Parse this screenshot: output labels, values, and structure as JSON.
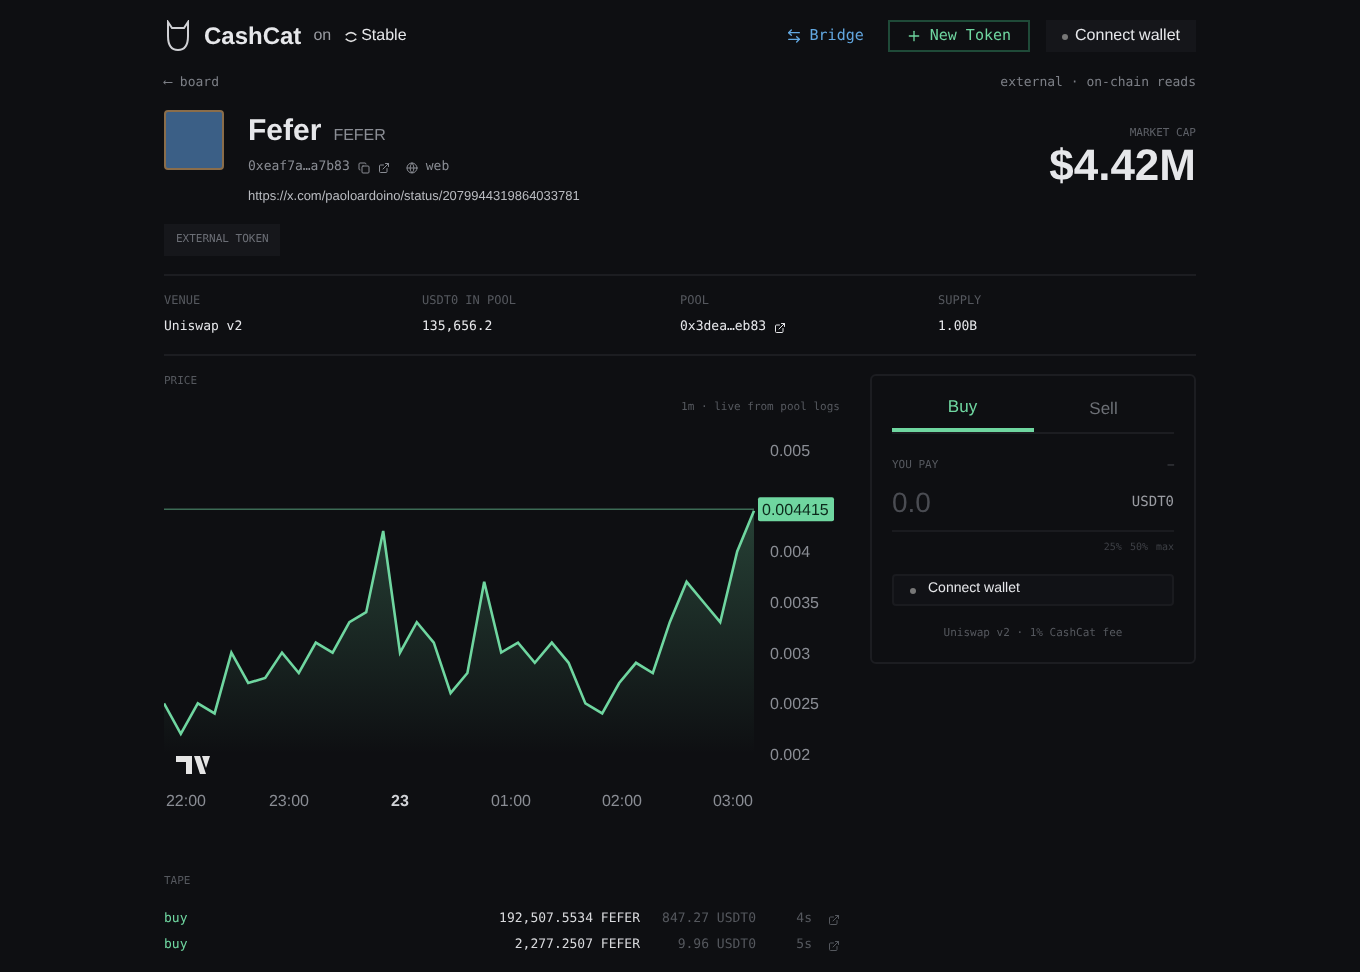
{
  "header": {
    "brand": "CashCat",
    "on": "on",
    "network": "Stable",
    "bridge": "Bridge",
    "new_token": "New Token",
    "connect": "Connect wallet"
  },
  "back_arrow": "⟵",
  "back": "board",
  "source_note": "external · on-chain reads",
  "token": {
    "name": "Fefer",
    "symbol": "FEFER",
    "address": "0xeaf7a…a7b83",
    "web": "web",
    "url": "https://x.com/paoloardoino/status/2079944319864033781",
    "badge": "EXTERNAL TOKEN"
  },
  "market_cap": {
    "label": "MARKET CAP",
    "value": "$4.42M"
  },
  "stats": [
    {
      "label": "VENUE",
      "value": "Uniswap v2",
      "link": false
    },
    {
      "label": "USDT0 IN POOL",
      "value": "135,656.2",
      "link": false
    },
    {
      "label": "POOL",
      "value": "0x3dea…eb83",
      "link": true
    },
    {
      "label": "SUPPLY",
      "value": "1.00B",
      "link": false
    }
  ],
  "price": {
    "title": "PRICE",
    "note": "1m · live from pool logs",
    "time_labels": [
      "22:00",
      "23:00",
      "23",
      "01:00",
      "02:00",
      "03:00"
    ],
    "chart_data": {
      "type": "area",
      "series": [
        {
          "color": "#6fd6a0",
          "values": [
            0.0025,
            0.0022,
            0.0025,
            0.0024,
            0.003,
            0.0027,
            0.00275,
            0.003,
            0.0028,
            0.0031,
            0.003,
            0.0033,
            0.0034,
            0.0042,
            0.003,
            0.0033,
            0.0031,
            0.0026,
            0.0028,
            0.0037,
            0.003,
            0.0031,
            0.0029,
            0.0031,
            0.0029,
            0.0025,
            0.0024,
            0.0027,
            0.0029,
            0.0028,
            0.0033,
            0.0037,
            0.0035,
            0.0033,
            0.004,
            0.0044
          ]
        }
      ],
      "ylim": [
        0.002,
        0.005
      ],
      "yticks": [
        {
          "value": 0.002,
          "label": "0.002"
        },
        {
          "value": 0.0025,
          "label": "0.0025"
        },
        {
          "value": 0.003,
          "label": "0.003"
        },
        {
          "value": 0.0035,
          "label": "0.0035"
        },
        {
          "value": 0.004,
          "label": "0.004"
        },
        {
          "value": 0.005,
          "label": "0.005"
        }
      ],
      "ref_lines": [
        {
          "axis": "y",
          "value": 0.004415,
          "label": "0.004415",
          "color": "#3c6b55"
        }
      ]
    }
  },
  "trade": {
    "tabs": [
      {
        "label": "Buy",
        "selected": true
      },
      {
        "label": "Sell",
        "selected": false
      }
    ],
    "pay_label": "YOU PAY",
    "balance": "—",
    "amount_placeholder": "0.0",
    "currency": "USDT0",
    "presets": [
      "25%",
      "50%",
      "max"
    ],
    "connect": "Connect wallet",
    "footer": "Uniswap v2 · 1% CashCat fee"
  },
  "tape": {
    "title": "TAPE",
    "rows": [
      {
        "side": "buy",
        "amount": "192,507.5534 FEFER",
        "usd": "847.27 USDT0",
        "age": "4s"
      },
      {
        "side": "buy",
        "amount": "2,277.2507 FEFER",
        "usd": "9.96 USDT0",
        "age": "5s"
      }
    ]
  }
}
